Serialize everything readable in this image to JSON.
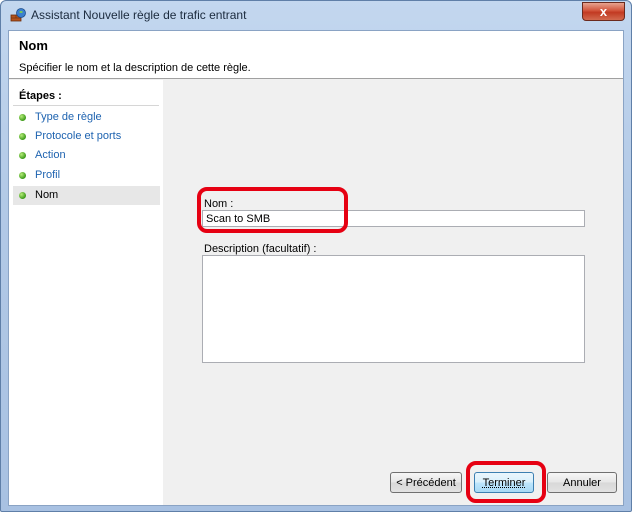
{
  "window": {
    "title": "Assistant Nouvelle règle de trafic entrant",
    "close_glyph": "x"
  },
  "header": {
    "title": "Nom",
    "description": "Spécifier le nom et la description de cette règle."
  },
  "steps": {
    "heading": "Étapes :",
    "items": [
      {
        "label": "Type de règle",
        "state": "completed"
      },
      {
        "label": "Protocole et ports",
        "state": "completed"
      },
      {
        "label": "Action",
        "state": "completed"
      },
      {
        "label": "Profil",
        "state": "completed"
      },
      {
        "label": "Nom",
        "state": "current"
      }
    ]
  },
  "form": {
    "name_label": "Nom :",
    "name_value": "Scan to SMB",
    "description_label": "Description (facultatif) :",
    "description_value": ""
  },
  "buttons": {
    "previous": "< Précédent",
    "finish": "Terminer",
    "cancel": "Annuler"
  },
  "colors": {
    "highlight": "#e60012",
    "link": "#1e63b0",
    "step_dot": "#3c9a18"
  },
  "icons": {
    "title": "firewall-wizard-icon",
    "close": "close-icon",
    "step": "green-dot-icon"
  }
}
